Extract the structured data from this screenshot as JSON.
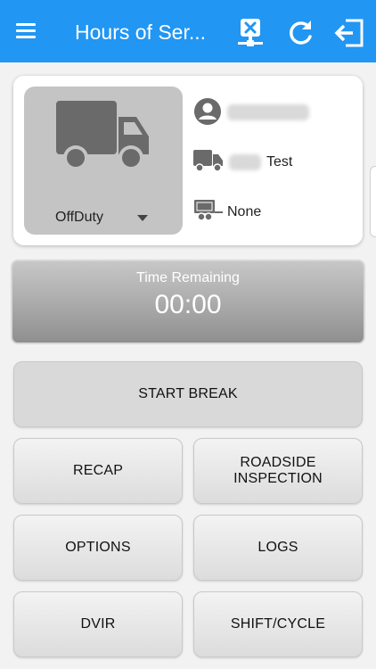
{
  "header": {
    "title": "Hours of Ser...",
    "menu_icon": "menu-icon",
    "network_icon": "network-disconnected-icon",
    "refresh_icon": "refresh-icon",
    "logout_icon": "logout-icon"
  },
  "status_card": {
    "duty_status": "OffDuty",
    "driver_icon": "person-circle-icon",
    "vehicle_icon": "truck-icon",
    "vehicle_suffix": "Test",
    "trailer_icon": "trailer-icon",
    "trailer": "None"
  },
  "time_remaining": {
    "label": "Time Remaining",
    "value": "00:00"
  },
  "buttons": {
    "start_break": "START BREAK",
    "recap": "RECAP",
    "roadside_inspection": "ROADSIDE INSPECTION",
    "options": "OPTIONS",
    "logs": "LOGS",
    "dvir": "DVIR",
    "shift_cycle": "SHIFT/CYCLE"
  },
  "colors": {
    "header": "#2196f3",
    "icon_gray": "#6a6a6a"
  }
}
